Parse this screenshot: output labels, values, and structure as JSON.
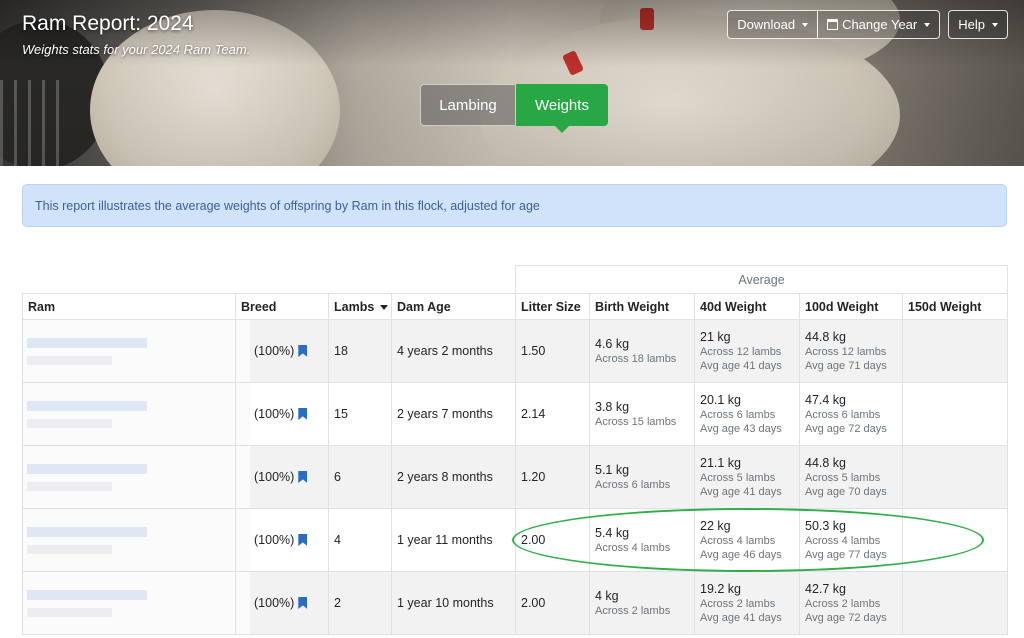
{
  "header": {
    "title": "Ram Report: 2024",
    "subtitle": "Weights stats for your 2024 Ram Team.",
    "buttons": {
      "download": "Download",
      "change_year": "Change Year",
      "help": "Help"
    },
    "tabs": {
      "lambing": "Lambing",
      "weights": "Weights"
    }
  },
  "alert": {
    "text": "This report illustrates the average weights of offspring by Ram in this flock, adjusted for age"
  },
  "table": {
    "group_header": "Average",
    "columns": [
      "Ram",
      "Breed",
      "Lambs",
      "Dam Age",
      "Litter Size",
      "Birth Weight",
      "40d Weight",
      "100d Weight",
      "150d Weight"
    ],
    "rows": [
      {
        "breed": "(100%)",
        "lambs": "18",
        "dam_age": "4 years 2 months",
        "litter": "1.50",
        "birth": "4.6 kg",
        "birth_sub": "Across 18 lambs",
        "w40": "21 kg",
        "w40_sub1": "Across 12 lambs",
        "w40_sub2": "Avg age 41 days",
        "w100": "44.8 kg",
        "w100_sub1": "Across 12 lambs",
        "w100_sub2": "Avg age 71 days"
      },
      {
        "breed": "(100%)",
        "lambs": "15",
        "dam_age": "2 years 7 months",
        "litter": "2.14",
        "birth": "3.8 kg",
        "birth_sub": "Across 15 lambs",
        "w40": "20.1 kg",
        "w40_sub1": "Across 6 lambs",
        "w40_sub2": "Avg age 43 days",
        "w100": "47.4 kg",
        "w100_sub1": "Across 6 lambs",
        "w100_sub2": "Avg age 72 days"
      },
      {
        "breed": "(100%)",
        "lambs": "6",
        "dam_age": "2 years 8 months",
        "litter": "1.20",
        "birth": "5.1 kg",
        "birth_sub": "Across 6 lambs",
        "w40": "21.1 kg",
        "w40_sub1": "Across 5 lambs",
        "w40_sub2": "Avg age 41 days",
        "w100": "44.8 kg",
        "w100_sub1": "Across 5 lambs",
        "w100_sub2": "Avg age 70 days"
      },
      {
        "breed": "(100%)",
        "lambs": "4",
        "dam_age": "1 year 11 months",
        "litter": "2.00",
        "birth": "5.4 kg",
        "birth_sub": "Across 4 lambs",
        "w40": "22 kg",
        "w40_sub1": "Across 4 lambs",
        "w40_sub2": "Avg age 46 days",
        "w100": "50.3 kg",
        "w100_sub1": "Across 4 lambs",
        "w100_sub2": "Avg age 77 days"
      },
      {
        "breed": "(100%)",
        "lambs": "2",
        "dam_age": "1 year 10 months",
        "litter": "2.00",
        "birth": "4 kg",
        "birth_sub": "Across 2 lambs",
        "w40": "19.2 kg",
        "w40_sub1": "Across 2 lambs",
        "w40_sub2": "Avg age 41 days",
        "w100": "42.7 kg",
        "w100_sub1": "Across 2 lambs",
        "w100_sub2": "Avg age 72 days"
      }
    ]
  },
  "colors": {
    "accent_green": "#28a745",
    "alert_bg": "#d1e3fb",
    "alert_text": "#3d5f94",
    "bookmark": "#2c6bc4"
  },
  "icons": {
    "bookmark": "bookmark-icon",
    "calendar": "calendar-icon",
    "caret": "caret-down-icon"
  }
}
